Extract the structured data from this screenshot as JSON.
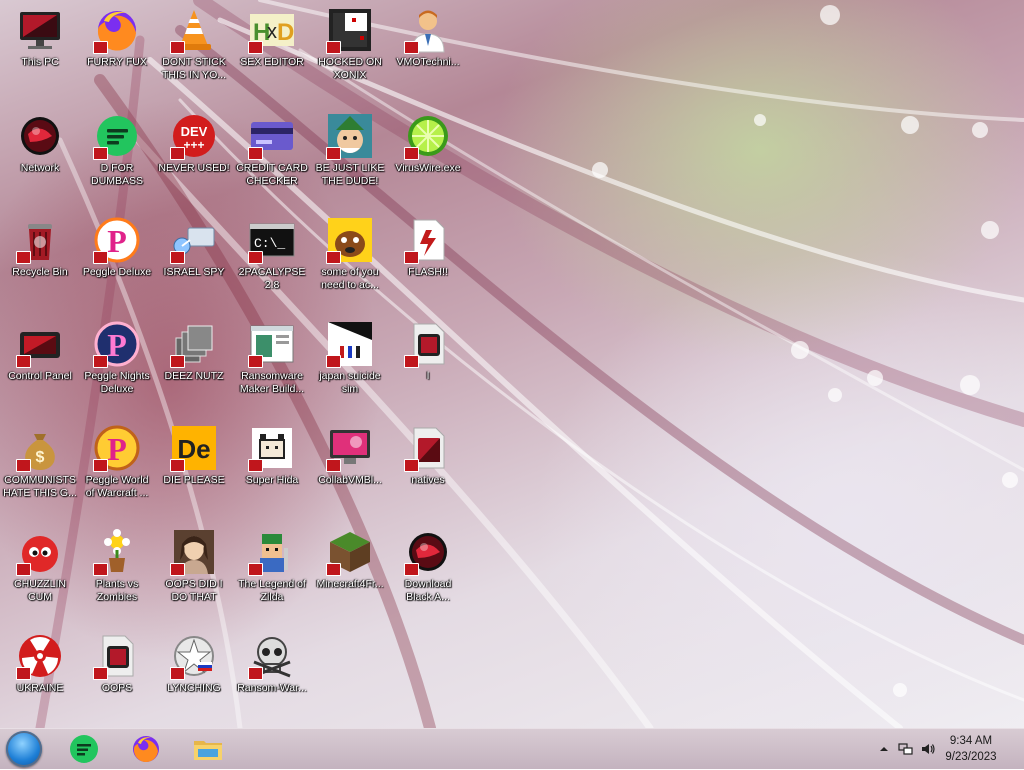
{
  "desktop": {
    "icons": [
      {
        "label": "This PC",
        "icon": "monitor-icon"
      },
      {
        "label": "FURRY FUX",
        "icon": "firefox-icon"
      },
      {
        "label": "DONT STICK THIS IN YO...",
        "icon": "vlc-cone-icon"
      },
      {
        "label": "SEX EDITOR",
        "icon": "hxd-editor-icon"
      },
      {
        "label": "HOCKED ON XONIX",
        "icon": "xonix-game-icon"
      },
      {
        "label": "VMOTechni...",
        "icon": "doctor-avatar-icon"
      },
      {
        "label": "Network",
        "icon": "network-orb-icon"
      },
      {
        "label": "D FOR DUMBASS",
        "icon": "green-chat-icon"
      },
      {
        "label": "NEVER USED!",
        "icon": "devcpp-icon"
      },
      {
        "label": "CREDIT CARD CHECKER",
        "icon": "credit-card-icon"
      },
      {
        "label": "BE JUST LIKE THE DUDE!",
        "icon": "elf-face-icon"
      },
      {
        "label": "VirusWire.exe",
        "icon": "lime-icon"
      },
      {
        "label": "Recycle Bin",
        "icon": "recycle-bin-icon"
      },
      {
        "label": "Peggle Deluxe",
        "icon": "peggle-icon"
      },
      {
        "label": "ISRAEL SPY",
        "icon": "network-cable-icon"
      },
      {
        "label": "2PACALYPSE 2.8",
        "icon": "terminal-icon"
      },
      {
        "label": "some of you need to ac...",
        "icon": "dog-face-icon"
      },
      {
        "label": "FLASH!!",
        "icon": "flash-file-icon"
      },
      {
        "label": "Control Panel",
        "icon": "control-panel-icon"
      },
      {
        "label": "Peggle Nights Deluxe",
        "icon": "peggle-nights-icon"
      },
      {
        "label": "DEEZ NUTZ",
        "icon": "stacked-windows-icon"
      },
      {
        "label": "Ransomware Maker Build...",
        "icon": "app-window-icon"
      },
      {
        "label": "japan suicide sim",
        "icon": "figures-icon"
      },
      {
        "label": "l",
        "icon": "shortcut-file-icon"
      },
      {
        "label": "COMMUNISTS HATE THIS G...",
        "icon": "money-bag-icon"
      },
      {
        "label": "Peggle World of Warcraft ...",
        "icon": "peggle-wow-icon"
      },
      {
        "label": "DIE PLEASE",
        "icon": "de-tile-icon"
      },
      {
        "label": "Super Hida",
        "icon": "pixel-cat-icon"
      },
      {
        "label": "CollabVMBl...",
        "icon": "collab-monitor-icon"
      },
      {
        "label": "natives",
        "icon": "natives-file-icon"
      },
      {
        "label": "CHUZZLIN CUM",
        "icon": "chuzzle-icon"
      },
      {
        "label": "Plants vs Zombies",
        "icon": "flower-pot-icon"
      },
      {
        "label": "OOPS DID I DO THAT",
        "icon": "portrait-icon"
      },
      {
        "label": "The Legend of Zilda",
        "icon": "pixel-hero-icon"
      },
      {
        "label": "Minecraft4Fr...",
        "icon": "grass-block-icon"
      },
      {
        "label": "Download Black A...",
        "icon": "network-orb-icon"
      },
      {
        "label": "UKRAINE",
        "icon": "radiation-icon"
      },
      {
        "label": "OOPS",
        "icon": "shortcut-file-icon"
      },
      {
        "label": "LYNCHING",
        "icon": "emblem-icon"
      },
      {
        "label": "Ransom-War...",
        "icon": "skull-icon"
      }
    ]
  },
  "taskbar": {
    "start_icon": "start-orb-icon",
    "apps": [
      {
        "name": "chat-app",
        "icon": "green-chat-icon"
      },
      {
        "name": "firefox",
        "icon": "firefox-icon"
      },
      {
        "name": "file-explorer",
        "icon": "folder-icon"
      }
    ],
    "tray": {
      "time": "9:34 AM",
      "date": "9/23/2023"
    }
  },
  "colors": {
    "taskbar": "#c8b8c3",
    "badge": "#c0161c",
    "start": "#1e7fd6"
  }
}
